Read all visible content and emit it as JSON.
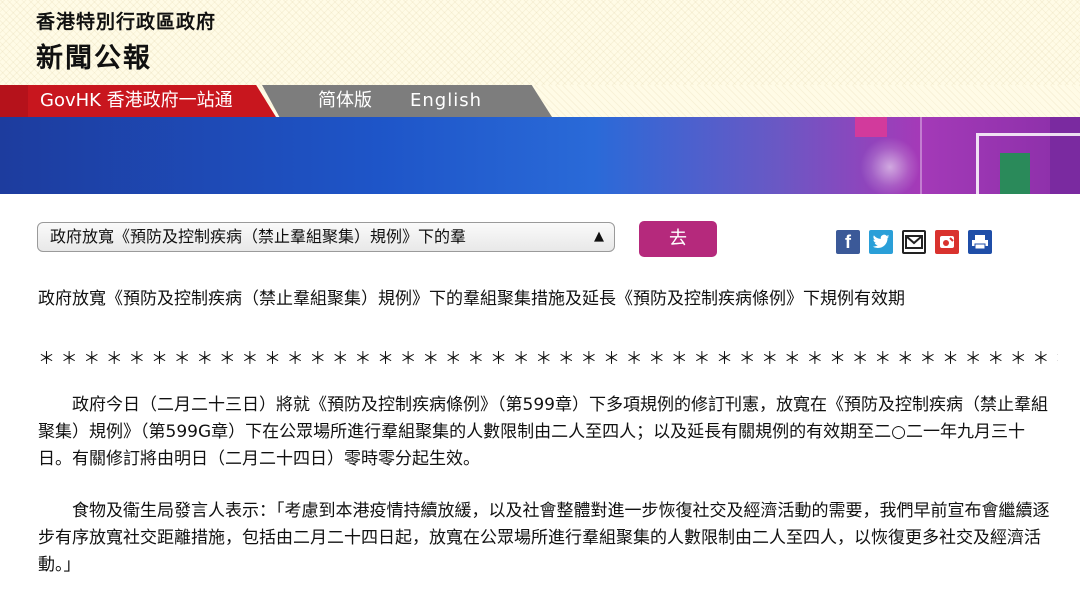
{
  "header": {
    "gov_name": "香港特別行政區政府",
    "press_title": "新聞公報"
  },
  "nav": {
    "govhk": "GovHK 香港政府一站通",
    "simplified": "简体版",
    "english": "English"
  },
  "toolbar": {
    "select_value": "政府放寬《預防及控制疾病（禁止羣組聚集）規例》下的羣",
    "go_label": "去",
    "share_icons": [
      "facebook-icon",
      "twitter-icon",
      "email-icon",
      "weibo-icon",
      "print-icon"
    ]
  },
  "article": {
    "title": "政府放寬《預防及控制疾病（禁止羣組聚集）規例》下的羣組聚集措施及延長《預防及控制疾病條例》下規例有效期",
    "stars": "＊＊＊＊＊＊＊＊＊＊＊＊＊＊＊＊＊＊＊＊＊＊＊＊＊＊＊＊＊＊＊＊＊＊＊＊＊＊＊＊＊＊＊＊＊＊＊＊＊＊＊＊＊",
    "paragraphs": [
      "政府今日（二月二十三日）將就《預防及控制疾病條例》（第599章）下多項規例的修訂刊憲，放寬在《預防及控制疾病（禁止羣組聚集）規例》（第599G章）下在公眾場所進行羣組聚集的人數限制由二人至四人；以及延長有關規例的有效期至二○二一年九月三十日。有關修訂將由明日（二月二十四日）零時零分起生效。",
      "食物及衞生局發言人表示：「考慮到本港疫情持續放緩，以及社會整體對進一步恢復社交及經濟活動的需要，我們早前宣布會繼續逐步有序放寬社交距離措施，包括由二月二十四日起，放寬在公眾場所進行羣組聚集的人數限制由二人至四人，以恢復更多社交及經濟活動。」"
    ]
  },
  "colors": {
    "nav_red": "#c8161e",
    "nav_gray": "#7d7d7d",
    "go_button": "#b5297c"
  }
}
